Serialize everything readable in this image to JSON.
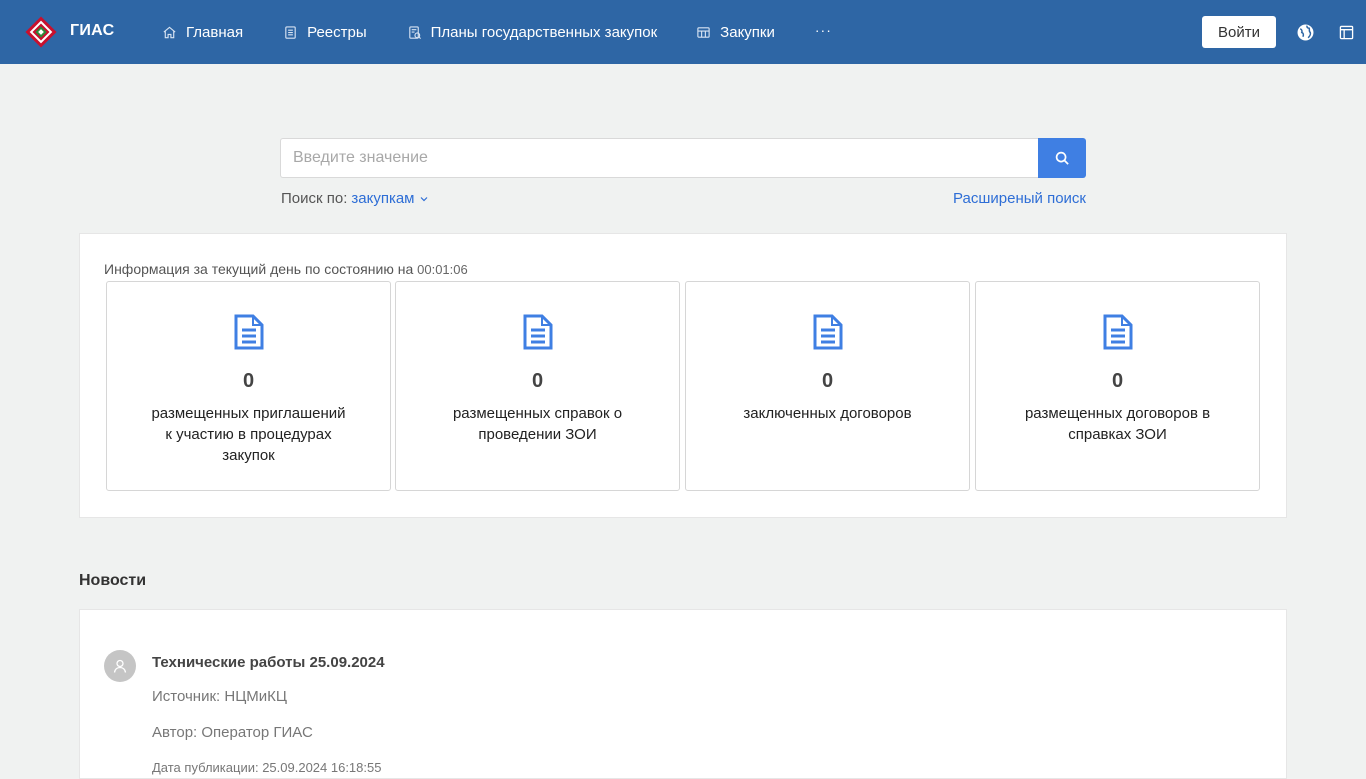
{
  "header": {
    "brand": "ГИАС",
    "nav": [
      {
        "label": "Главная",
        "icon": "home-icon"
      },
      {
        "label": "Реестры",
        "icon": "registry-icon"
      },
      {
        "label": "Планы государственных закупок",
        "icon": "plan-icon"
      },
      {
        "label": "Закупки",
        "icon": "procurement-icon"
      }
    ],
    "more": "···",
    "login": "Войти"
  },
  "search": {
    "placeholder": "Введите значение",
    "by_label": "Поиск по:",
    "by_value": "закупкам",
    "advanced": "Расширеный поиск"
  },
  "info": {
    "title": "Информация за текущий день по состоянию на",
    "time": "00:01:06",
    "cards": [
      {
        "count": "0",
        "label": "размещенных приглашений к участию в процедурах закупок"
      },
      {
        "count": "0",
        "label": "размещенных справок о проведении ЗОИ"
      },
      {
        "count": "0",
        "label": "заключенных договоров"
      },
      {
        "count": "0",
        "label": "размещенных договоров в справках ЗОИ"
      }
    ]
  },
  "news": {
    "heading": "Новости",
    "items": [
      {
        "title": "Технические работы 25.09.2024",
        "source": "Источник: НЦМиКЦ",
        "author": "Автор: Оператор ГИАС",
        "date": "Дата публикации: 25.09.2024 16:18:55"
      }
    ]
  },
  "colors": {
    "header_bg": "#2e66a5",
    "accent": "#3f7fe3",
    "link": "#2e6ed6",
    "page_bg": "#f0f2f1"
  }
}
